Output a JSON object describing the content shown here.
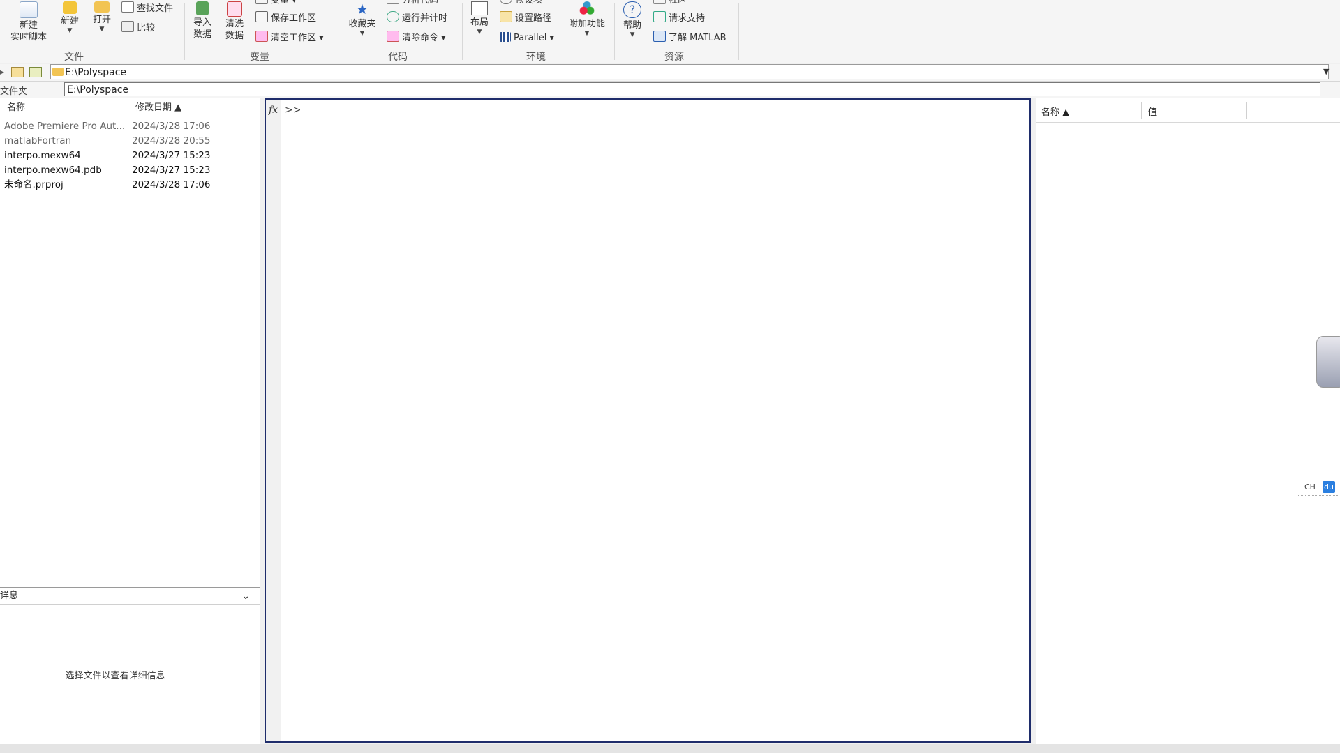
{
  "ribbon": {
    "groups": {
      "file": "文件",
      "variable": "变量",
      "code": "代码",
      "environment": "环境",
      "resources": "资源"
    },
    "new_live_script": [
      "新建",
      "实时脚本"
    ],
    "new": "新建",
    "open": "打开",
    "find_files": "查找文件",
    "compare": "比较",
    "import_data": [
      "导入",
      "数据"
    ],
    "clean_data": [
      "清洗",
      "数据"
    ],
    "variable_partial": "变量",
    "save_workspace": "保存工作区",
    "clear_workspace": "清空工作区",
    "favorites": "收藏夹",
    "analyze_code_partial": "分析代码",
    "run_and_time": "运行并计时",
    "clear_commands": "清除命令",
    "layout": "布局",
    "preferences_partial": "预设项",
    "set_path": "设置路径",
    "parallel": "Parallel",
    "add_ons": "附加功能",
    "help": "帮助",
    "community_partial": "社区",
    "request_support": "请求支持",
    "learn_matlab": "了解 MATLAB"
  },
  "address": {
    "path": "E:\\Polyspace"
  },
  "current_folder": {
    "label": "文件夹",
    "path": "E:\\Polyspace"
  },
  "file_browser": {
    "col_name": "名称",
    "col_date": "修改日期 ▲",
    "files": [
      {
        "name": "Adobe Premiere Pro Aut...",
        "date": "2024/3/28 17:06"
      },
      {
        "name": "matlabFortran",
        "date": "2024/3/28 20:55"
      },
      {
        "name": "interpo.mexw64",
        "date": "2024/3/27 15:23"
      },
      {
        "name": "interpo.mexw64.pdb",
        "date": "2024/3/27 15:23"
      },
      {
        "name": "未命名.prproj",
        "date": "2024/3/28 17:06"
      }
    ],
    "details_label": "详息",
    "details_message": "选择文件以查看详细信息"
  },
  "command_window": {
    "fx": "fx",
    "prompt": ">>"
  },
  "workspace": {
    "col_name": "名称 ▲",
    "col_value": "值"
  },
  "ime": {
    "lang": "CH",
    "brand": "du"
  },
  "colors": {
    "cmd_border": "#1f2d6b",
    "ribbon_bg": "#f5f5f5"
  }
}
